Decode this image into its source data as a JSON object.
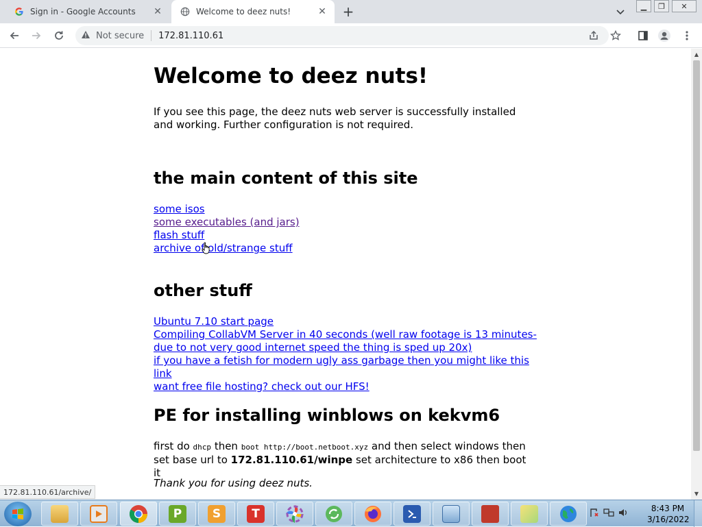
{
  "browser": {
    "tabs": [
      {
        "title": "Sign in - Google Accounts",
        "favicon": "google-icon",
        "active": false
      },
      {
        "title": "Welcome to deez nuts!",
        "favicon": "globe-icon",
        "active": true
      }
    ],
    "address": {
      "security_label": "Not secure",
      "url": "172.81.110.61"
    },
    "status_url": "172.81.110.61/archive/"
  },
  "page": {
    "title": "Welcome to deez nuts!",
    "intro": "If you see this page, the deez nuts web server is successfully installed and working. Further configuration is not required.",
    "section_main": {
      "heading": "the main content of this site",
      "links": [
        {
          "text": "some isos",
          "visited": false
        },
        {
          "text": "some executables (and jars)",
          "visited": true
        },
        {
          "text": "flash stuff",
          "visited": false
        },
        {
          "text": "archive of old/strange stuff",
          "visited": false
        }
      ]
    },
    "section_other": {
      "heading": "other stuff",
      "links": [
        {
          "text": "Ubuntu 7.10 start page"
        },
        {
          "text": "Compiling CollabVM Server in 40 seconds (well raw footage is 13 minutes- due to not very good internet speed the thing is sped up 20x)"
        },
        {
          "text": "if you have a fetish for modern ugly ass garbage then you might like this link"
        },
        {
          "text": "want free file hosting? check out our HFS!"
        }
      ]
    },
    "section_pe": {
      "heading": "PE for installing winblows on kekvm6",
      "text_1": "first do ",
      "code_1": "dhcp",
      "text_2": " then ",
      "code_2": "boot http://boot.netboot.xyz",
      "text_3": " and then select windows then set base url to ",
      "bold_url": "172.81.110.61/winpe",
      "text_4": " set architecture to x86 then boot it"
    },
    "footer": "Thank you for using deez nuts."
  },
  "taskbar": {
    "apps": [
      "file-explorer-icon",
      "media-player-icon",
      "chrome-icon",
      "p-app-icon",
      "s-app-icon",
      "t-app-icon",
      "pinwheel-icon",
      "sync-icon",
      "firefox-icon",
      "powershell-icon",
      "control-panel-icon",
      "toolbox-icon",
      "folders-icon",
      "globe-icon"
    ],
    "letters": {
      "p": "P",
      "s": "S",
      "t": "T"
    },
    "clock": {
      "time": "8:43 PM",
      "date": "3/16/2022"
    }
  }
}
